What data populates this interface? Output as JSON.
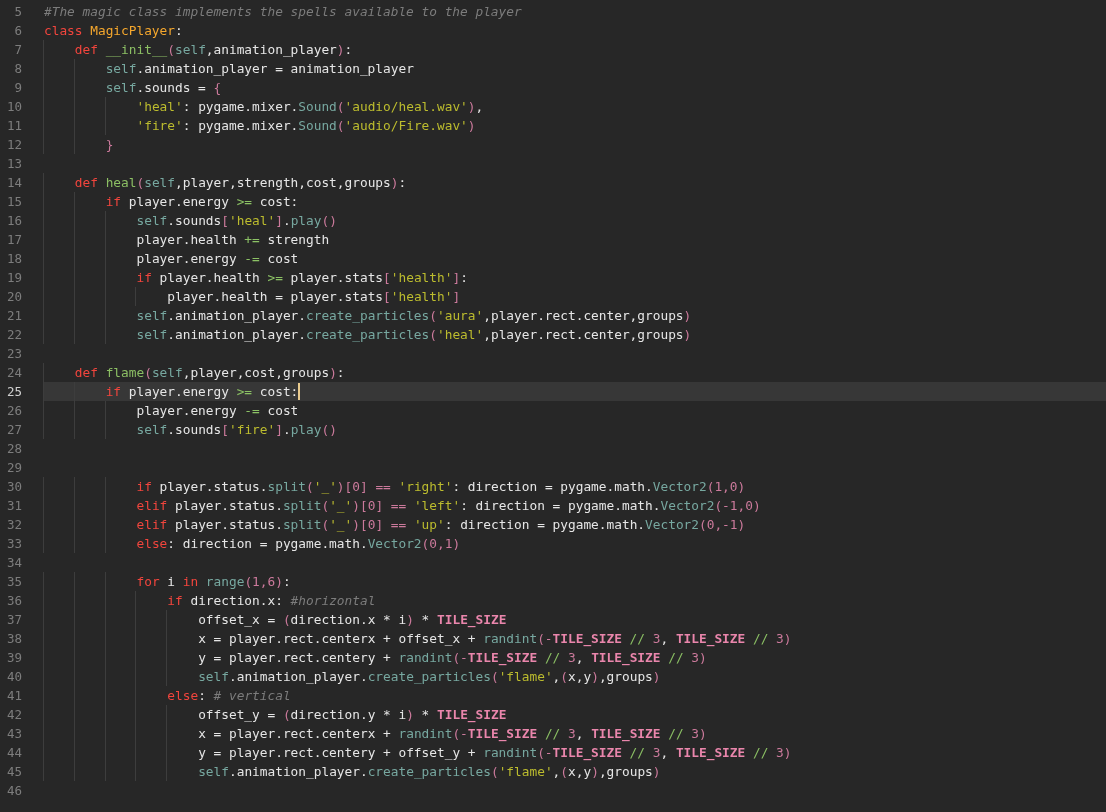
{
  "editor": {
    "lines": [
      {
        "number": "5",
        "current": false,
        "segments": [
          {
            "kind": "comment",
            "text": "#The magic class implements the spells available to the player"
          }
        ]
      },
      {
        "number": "6",
        "current": false,
        "segments": [
          {
            "kind": "keyword",
            "text": "class "
          },
          {
            "kind": "classname",
            "text": "MagicPlayer"
          },
          {
            "kind": "plain",
            "text": ":"
          }
        ]
      },
      {
        "number": "7",
        "current": false,
        "segments": [
          {
            "kind": "keyword",
            "text": "    def "
          },
          {
            "kind": "funcname",
            "text": "__init__"
          },
          {
            "kind": "pink",
            "text": "("
          },
          {
            "kind": "builtin",
            "text": "self"
          },
          {
            "kind": "plain",
            "text": ",animation_player"
          },
          {
            "kind": "pink",
            "text": ")"
          },
          {
            "kind": "plain",
            "text": ":"
          }
        ]
      },
      {
        "number": "8",
        "current": false,
        "segments": [
          {
            "kind": "builtin",
            "text": "        self"
          },
          {
            "kind": "plain",
            "text": ".animation_player = animation_player"
          }
        ]
      },
      {
        "number": "9",
        "current": false,
        "segments": [
          {
            "kind": "builtin",
            "text": "        self"
          },
          {
            "kind": "plain",
            "text": ".sounds = "
          },
          {
            "kind": "pink",
            "text": "{"
          }
        ]
      },
      {
        "number": "10",
        "current": false,
        "segments": [
          {
            "kind": "string",
            "text": "            'heal'"
          },
          {
            "kind": "plain",
            "text": ": pygame.mixer."
          },
          {
            "kind": "builtin",
            "text": "Sound"
          },
          {
            "kind": "pink",
            "text": "("
          },
          {
            "kind": "string",
            "text": "'audio/heal.wav'"
          },
          {
            "kind": "pink",
            "text": ")"
          },
          {
            "kind": "plain",
            "text": ","
          }
        ]
      },
      {
        "number": "11",
        "current": false,
        "segments": [
          {
            "kind": "string",
            "text": "            'fire'"
          },
          {
            "kind": "plain",
            "text": ": pygame.mixer."
          },
          {
            "kind": "builtin",
            "text": "Sound"
          },
          {
            "kind": "pink",
            "text": "("
          },
          {
            "kind": "string",
            "text": "'audio/Fire.wav'"
          },
          {
            "kind": "pink",
            "text": ")"
          }
        ]
      },
      {
        "number": "12",
        "current": false,
        "segments": [
          {
            "kind": "pink",
            "text": "        }"
          }
        ]
      },
      {
        "number": "13",
        "current": false
      },
      {
        "number": "14",
        "current": false,
        "segments": [
          {
            "kind": "keyword",
            "text": "    def "
          },
          {
            "kind": "funcname",
            "text": "heal"
          },
          {
            "kind": "pink",
            "text": "("
          },
          {
            "kind": "builtin",
            "text": "self"
          },
          {
            "kind": "plain",
            "text": ",player,strength,cost,groups"
          },
          {
            "kind": "pink",
            "text": ")"
          },
          {
            "kind": "plain",
            "text": ":"
          }
        ]
      },
      {
        "number": "15",
        "current": false,
        "segments": [
          {
            "kind": "keyword",
            "text": "        if "
          },
          {
            "kind": "plain",
            "text": "player.energy "
          },
          {
            "kind": "operator",
            "text": ">="
          },
          {
            "kind": "plain",
            "text": " cost:"
          }
        ]
      },
      {
        "number": "16",
        "current": false,
        "segments": [
          {
            "kind": "builtin",
            "text": "            self"
          },
          {
            "kind": "plain",
            "text": ".sounds"
          },
          {
            "kind": "pink",
            "text": "["
          },
          {
            "kind": "string",
            "text": "'heal'"
          },
          {
            "kind": "pink",
            "text": "]"
          },
          {
            "kind": "plain",
            "text": "."
          },
          {
            "kind": "builtin",
            "text": "play"
          },
          {
            "kind": "pink",
            "text": "()"
          }
        ]
      },
      {
        "number": "17",
        "current": false,
        "segments": [
          {
            "kind": "plain",
            "text": "            player.health "
          },
          {
            "kind": "operator",
            "text": "+="
          },
          {
            "kind": "plain",
            "text": " strength"
          }
        ]
      },
      {
        "number": "18",
        "current": false,
        "segments": [
          {
            "kind": "plain",
            "text": "            player.energy "
          },
          {
            "kind": "operator",
            "text": "-="
          },
          {
            "kind": "plain",
            "text": " cost"
          }
        ]
      },
      {
        "number": "19",
        "current": false,
        "segments": [
          {
            "kind": "keyword",
            "text": "            if "
          },
          {
            "kind": "plain",
            "text": "player.health "
          },
          {
            "kind": "operator",
            "text": ">="
          },
          {
            "kind": "plain",
            "text": " player.stats"
          },
          {
            "kind": "pink",
            "text": "["
          },
          {
            "kind": "string",
            "text": "'health'"
          },
          {
            "kind": "pink",
            "text": "]"
          },
          {
            "kind": "plain",
            "text": ":"
          }
        ]
      },
      {
        "number": "20",
        "current": false,
        "segments": [
          {
            "kind": "plain",
            "text": "                player.health = player.stats"
          },
          {
            "kind": "pink",
            "text": "["
          },
          {
            "kind": "string",
            "text": "'health'"
          },
          {
            "kind": "pink",
            "text": "]"
          }
        ]
      },
      {
        "number": "21",
        "current": false,
        "segments": [
          {
            "kind": "builtin",
            "text": "            self"
          },
          {
            "kind": "plain",
            "text": ".animation_player."
          },
          {
            "kind": "builtin",
            "text": "create_particles"
          },
          {
            "kind": "pink",
            "text": "("
          },
          {
            "kind": "string",
            "text": "'aura'"
          },
          {
            "kind": "plain",
            "text": ",player.rect.center,groups"
          },
          {
            "kind": "pink",
            "text": ")"
          }
        ]
      },
      {
        "number": "22",
        "current": false,
        "segments": [
          {
            "kind": "builtin",
            "text": "            self"
          },
          {
            "kind": "plain",
            "text": ".animation_player."
          },
          {
            "kind": "builtin",
            "text": "create_particles"
          },
          {
            "kind": "pink",
            "text": "("
          },
          {
            "kind": "string",
            "text": "'heal'"
          },
          {
            "kind": "plain",
            "text": ",player.rect.center,groups"
          },
          {
            "kind": "pink",
            "text": ")"
          }
        ]
      },
      {
        "number": "23",
        "current": false
      },
      {
        "number": "24",
        "current": false,
        "segments": [
          {
            "kind": "keyword",
            "text": "    def "
          },
          {
            "kind": "funcname",
            "text": "flame"
          },
          {
            "kind": "pink",
            "text": "("
          },
          {
            "kind": "builtin",
            "text": "self"
          },
          {
            "kind": "plain",
            "text": ",player,cost,groups"
          },
          {
            "kind": "pink",
            "text": ")"
          },
          {
            "kind": "plain",
            "text": ":"
          }
        ]
      },
      {
        "number": "25",
        "current": true,
        "segments": [
          {
            "kind": "keyword",
            "text": "        if "
          },
          {
            "kind": "plain",
            "text": "player.energy "
          },
          {
            "kind": "operator",
            "text": ">="
          },
          {
            "kind": "plain",
            "text": " cost:"
          }
        ]
      },
      {
        "number": "26",
        "current": false,
        "segments": [
          {
            "kind": "plain",
            "text": "            player.energy "
          },
          {
            "kind": "operator",
            "text": "-="
          },
          {
            "kind": "plain",
            "text": " cost"
          }
        ]
      },
      {
        "number": "27",
        "current": false,
        "segments": [
          {
            "kind": "builtin",
            "text": "            self"
          },
          {
            "kind": "plain",
            "text": ".sounds"
          },
          {
            "kind": "pink",
            "text": "["
          },
          {
            "kind": "string",
            "text": "'fire'"
          },
          {
            "kind": "pink",
            "text": "]"
          },
          {
            "kind": "plain",
            "text": "."
          },
          {
            "kind": "builtin",
            "text": "play"
          },
          {
            "kind": "pink",
            "text": "()"
          }
        ]
      },
      {
        "number": "28",
        "current": false
      },
      {
        "number": "29",
        "current": false
      },
      {
        "number": "30",
        "current": false,
        "segments": [
          {
            "kind": "keyword",
            "text": "            if "
          },
          {
            "kind": "plain",
            "text": "player.status."
          },
          {
            "kind": "builtin",
            "text": "split"
          },
          {
            "kind": "pink",
            "text": "("
          },
          {
            "kind": "string",
            "text": "'_'"
          },
          {
            "kind": "pink",
            "text": ")[0] == "
          },
          {
            "kind": "string",
            "text": "'right'"
          },
          {
            "kind": "plain",
            "text": ": direction = pygame.math."
          },
          {
            "kind": "builtin",
            "text": "Vector2"
          },
          {
            "kind": "pink",
            "text": "(1,0)"
          }
        ]
      },
      {
        "number": "31",
        "current": false,
        "segments": [
          {
            "kind": "keyword",
            "text": "            elif "
          },
          {
            "kind": "plain",
            "text": "player.status."
          },
          {
            "kind": "builtin",
            "text": "split"
          },
          {
            "kind": "pink",
            "text": "("
          },
          {
            "kind": "string",
            "text": "'_'"
          },
          {
            "kind": "pink",
            "text": ")[0] == "
          },
          {
            "kind": "string",
            "text": "'left'"
          },
          {
            "kind": "plain",
            "text": ": direction = pygame.math."
          },
          {
            "kind": "builtin",
            "text": "Vector2"
          },
          {
            "kind": "pink",
            "text": "(-1,0)"
          }
        ]
      },
      {
        "number": "32",
        "current": false,
        "segments": [
          {
            "kind": "keyword",
            "text": "            elif "
          },
          {
            "kind": "plain",
            "text": "player.status."
          },
          {
            "kind": "builtin",
            "text": "split"
          },
          {
            "kind": "pink",
            "text": "("
          },
          {
            "kind": "string",
            "text": "'_'"
          },
          {
            "kind": "pink",
            "text": ")[0] == "
          },
          {
            "kind": "string",
            "text": "'up'"
          },
          {
            "kind": "plain",
            "text": ": direction = pygame.math."
          },
          {
            "kind": "builtin",
            "text": "Vector2"
          },
          {
            "kind": "pink",
            "text": "(0,-1)"
          }
        ]
      },
      {
        "number": "33",
        "current": false,
        "segments": [
          {
            "kind": "keyword",
            "text": "            else"
          },
          {
            "kind": "plain",
            "text": ": direction = pygame.math."
          },
          {
            "kind": "builtin",
            "text": "Vector2"
          },
          {
            "kind": "pink",
            "text": "(0,1)"
          }
        ]
      },
      {
        "number": "34",
        "current": false
      },
      {
        "number": "35",
        "current": false,
        "segments": [
          {
            "kind": "keyword",
            "text": "            for "
          },
          {
            "kind": "plain",
            "text": "i "
          },
          {
            "kind": "keyword",
            "text": "in "
          },
          {
            "kind": "builtin",
            "text": "range"
          },
          {
            "kind": "pink",
            "text": "(1,6)"
          },
          {
            "kind": "plain",
            "text": ":"
          }
        ]
      },
      {
        "number": "36",
        "current": false,
        "segments": [
          {
            "kind": "keyword",
            "text": "                if "
          },
          {
            "kind": "plain",
            "text": "direction.x: "
          },
          {
            "kind": "comment",
            "text": "#horizontal"
          }
        ]
      },
      {
        "number": "37",
        "current": false,
        "segments": [
          {
            "kind": "plain",
            "text": "                    offset_x = "
          },
          {
            "kind": "pink",
            "text": "("
          },
          {
            "kind": "plain",
            "text": "direction.x * i"
          },
          {
            "kind": "pink",
            "text": ")"
          },
          {
            "kind": "plain",
            "text": " * "
          },
          {
            "kind": "constant",
            "text": "TILE_SIZE"
          }
        ]
      },
      {
        "number": "38",
        "current": false,
        "segments": [
          {
            "kind": "plain",
            "text": "                    x = player.rect.centerx + offset_x + "
          },
          {
            "kind": "builtin",
            "text": "randint"
          },
          {
            "kind": "pink",
            "text": "(-"
          },
          {
            "kind": "constant",
            "text": "TILE_SIZE"
          },
          {
            "kind": "operator",
            "text": " // "
          },
          {
            "kind": "pink",
            "text": "3"
          },
          {
            "kind": "plain",
            "text": ", "
          },
          {
            "kind": "constant",
            "text": "TILE_SIZE"
          },
          {
            "kind": "operator",
            "text": " // "
          },
          {
            "kind": "pink",
            "text": "3)"
          }
        ]
      },
      {
        "number": "39",
        "current": false,
        "segments": [
          {
            "kind": "plain",
            "text": "                    y = player.rect.centery + "
          },
          {
            "kind": "builtin",
            "text": "randint"
          },
          {
            "kind": "pink",
            "text": "(-"
          },
          {
            "kind": "constant",
            "text": "TILE_SIZE"
          },
          {
            "kind": "operator",
            "text": " // "
          },
          {
            "kind": "pink",
            "text": "3"
          },
          {
            "kind": "plain",
            "text": ", "
          },
          {
            "kind": "constant",
            "text": "TILE_SIZE"
          },
          {
            "kind": "operator",
            "text": " // "
          },
          {
            "kind": "pink",
            "text": "3)"
          }
        ]
      },
      {
        "number": "40",
        "current": false,
        "segments": [
          {
            "kind": "builtin",
            "text": "                    self"
          },
          {
            "kind": "plain",
            "text": ".animation_player."
          },
          {
            "kind": "builtin",
            "text": "create_particles"
          },
          {
            "kind": "pink",
            "text": "("
          },
          {
            "kind": "string",
            "text": "'flame'"
          },
          {
            "kind": "plain",
            "text": ","
          },
          {
            "kind": "pink",
            "text": "("
          },
          {
            "kind": "plain",
            "text": "x,y"
          },
          {
            "kind": "pink",
            "text": ")"
          },
          {
            "kind": "plain",
            "text": ",groups"
          },
          {
            "kind": "pink",
            "text": ")"
          }
        ]
      },
      {
        "number": "41",
        "current": false,
        "segments": [
          {
            "kind": "keyword",
            "text": "                else"
          },
          {
            "kind": "plain",
            "text": ": "
          },
          {
            "kind": "comment",
            "text": "# vertical"
          }
        ]
      },
      {
        "number": "42",
        "current": false,
        "segments": [
          {
            "kind": "plain",
            "text": "                    offset_y = "
          },
          {
            "kind": "pink",
            "text": "("
          },
          {
            "kind": "plain",
            "text": "direction.y * i"
          },
          {
            "kind": "pink",
            "text": ")"
          },
          {
            "kind": "plain",
            "text": " * "
          },
          {
            "kind": "constant",
            "text": "TILE_SIZE"
          }
        ]
      },
      {
        "number": "43",
        "current": false,
        "segments": [
          {
            "kind": "plain",
            "text": "                    x = player.rect.centerx + "
          },
          {
            "kind": "builtin",
            "text": "randint"
          },
          {
            "kind": "pink",
            "text": "(-"
          },
          {
            "kind": "constant",
            "text": "TILE_SIZE"
          },
          {
            "kind": "operator",
            "text": " // "
          },
          {
            "kind": "pink",
            "text": "3"
          },
          {
            "kind": "plain",
            "text": ", "
          },
          {
            "kind": "constant",
            "text": "TILE_SIZE"
          },
          {
            "kind": "operator",
            "text": " // "
          },
          {
            "kind": "pink",
            "text": "3)"
          }
        ]
      },
      {
        "number": "44",
        "current": false,
        "segments": [
          {
            "kind": "plain",
            "text": "                    y = player.rect.centery + offset_y + "
          },
          {
            "kind": "builtin",
            "text": "randint"
          },
          {
            "kind": "pink",
            "text": "(-"
          },
          {
            "kind": "constant",
            "text": "TILE_SIZE"
          },
          {
            "kind": "operator",
            "text": " // "
          },
          {
            "kind": "pink",
            "text": "3"
          },
          {
            "kind": "plain",
            "text": ", "
          },
          {
            "kind": "constant",
            "text": "TILE_SIZE"
          },
          {
            "kind": "operator",
            "text": " // "
          },
          {
            "kind": "pink",
            "text": "3)"
          }
        ]
      },
      {
        "number": "45",
        "current": false,
        "segments": [
          {
            "kind": "builtin",
            "text": "                    self"
          },
          {
            "kind": "plain",
            "text": ".animation_player."
          },
          {
            "kind": "builtin",
            "text": "create_particles"
          },
          {
            "kind": "pink",
            "text": "("
          },
          {
            "kind": "string",
            "text": "'flame'"
          },
          {
            "kind": "plain",
            "text": ","
          },
          {
            "kind": "pink",
            "text": "("
          },
          {
            "kind": "plain",
            "text": "x,y"
          },
          {
            "kind": "pink",
            "text": ")"
          },
          {
            "kind": "plain",
            "text": ",groups"
          },
          {
            "kind": "pink",
            "text": ")"
          }
        ]
      },
      {
        "number": "46",
        "current": false
      }
    ]
  }
}
